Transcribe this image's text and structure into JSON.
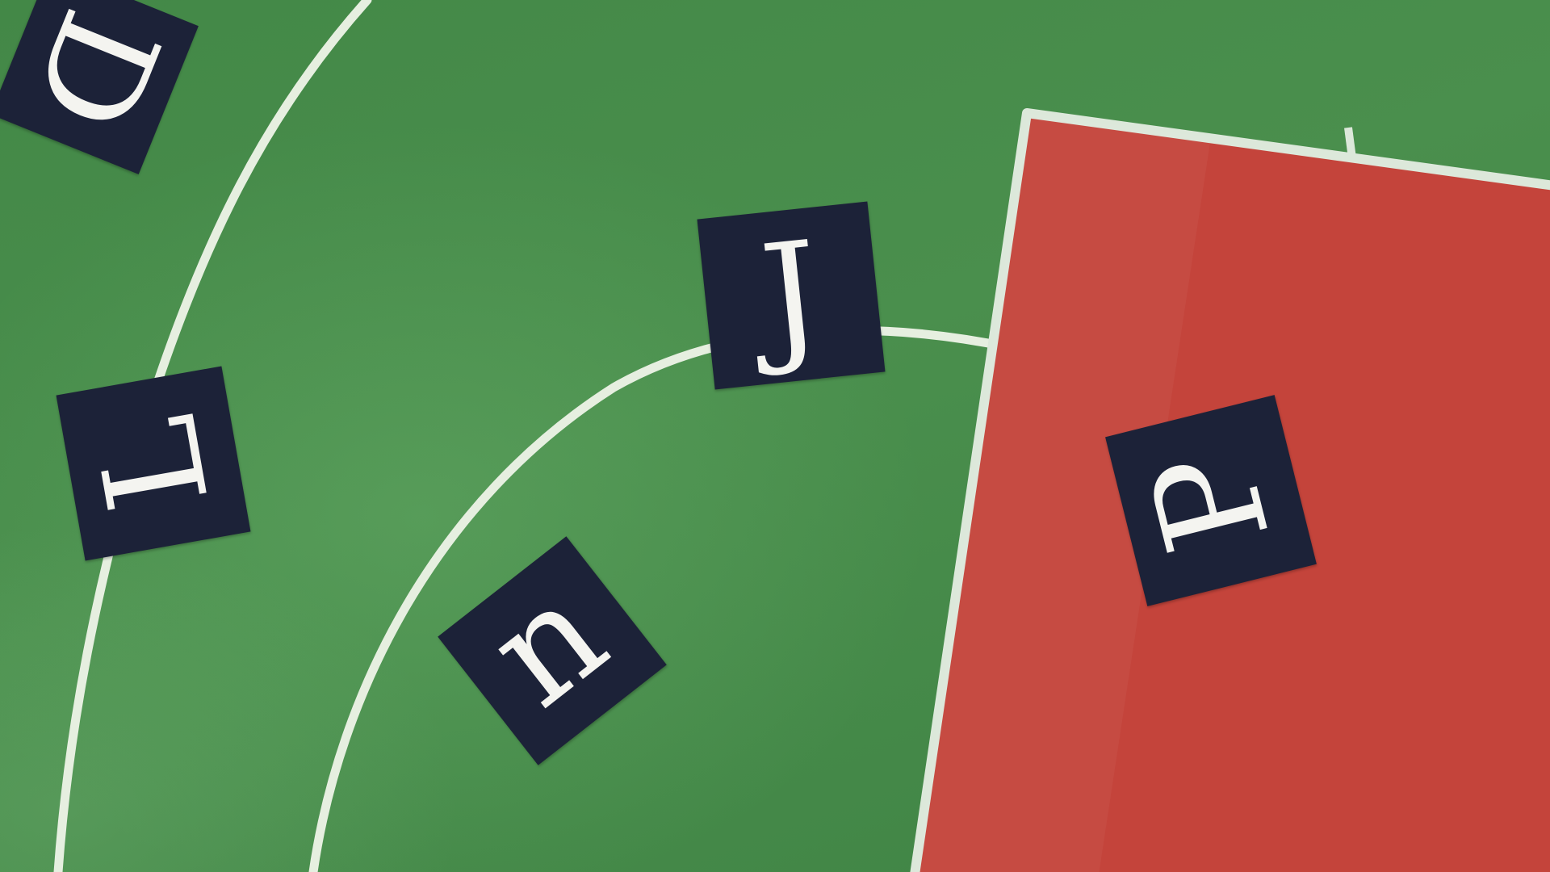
{
  "scene": {
    "description_colors": {
      "court_green": "#438847",
      "key_red": "#c4443b",
      "line_white": "#e6efe0",
      "tile_navy": "#1c2238",
      "letter_white": "#f4f4f0"
    }
  },
  "tiles": {
    "d": {
      "letter": "D"
    },
    "l": {
      "letter": "L"
    },
    "j": {
      "letter": "J"
    },
    "n": {
      "letter": "n"
    },
    "p": {
      "letter": "P"
    }
  }
}
